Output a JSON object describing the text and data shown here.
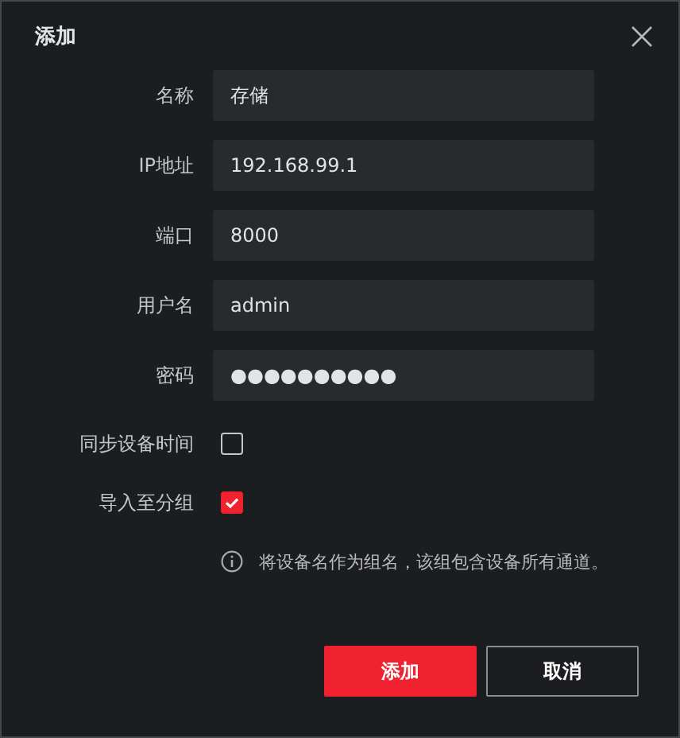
{
  "window": {
    "title": "添加"
  },
  "fields": [
    {
      "label": "名称",
      "value": "存储"
    },
    {
      "label": "IP地址",
      "value": "192.168.99.1"
    },
    {
      "label": "端口",
      "value": "8000"
    },
    {
      "label": "用户名",
      "value": "admin"
    },
    {
      "label": "密码",
      "value": "●●●●●●●●●●"
    }
  ],
  "options": [
    {
      "label": "同步设备时间",
      "checked": false
    },
    {
      "label": "导入至分组",
      "checked": true
    }
  ],
  "hint": "将设备名作为组名，该组包含设备所有通道。",
  "buttons": [
    {
      "label": "添加",
      "kind": "primary"
    },
    {
      "label": "取消",
      "kind": "secondary"
    }
  ]
}
